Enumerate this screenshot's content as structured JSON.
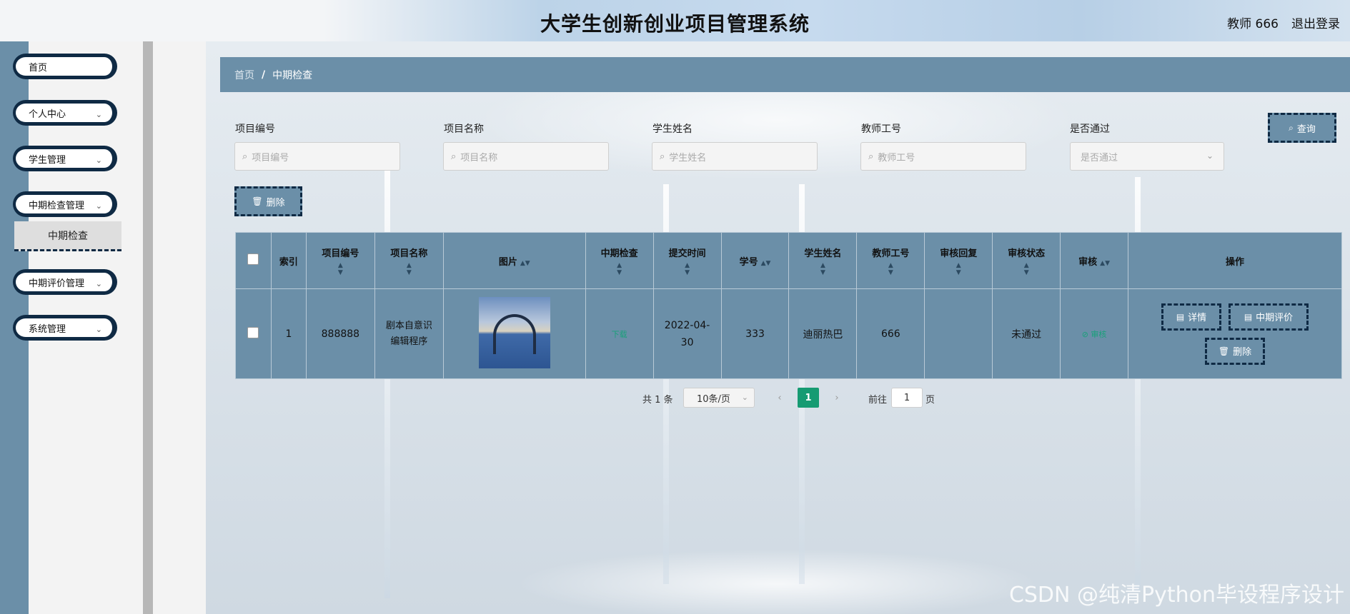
{
  "header": {
    "title": "大学生创新创业项目管理系统",
    "user": "教师 666",
    "logout": "退出登录"
  },
  "sidebar": {
    "items": [
      {
        "label": "首页"
      },
      {
        "label": "个人中心"
      },
      {
        "label": "学生管理"
      },
      {
        "label": "中期检查管理"
      },
      {
        "label": "中期评价管理"
      },
      {
        "label": "系统管理"
      }
    ],
    "subitem": "中期检查",
    "chevron": "⌄"
  },
  "breadcrumb": {
    "home": "首页",
    "separator": "/",
    "current": "中期检查"
  },
  "filters": {
    "project_no": {
      "label": "项目编号",
      "placeholder": "项目编号"
    },
    "project_name": {
      "label": "项目名称",
      "placeholder": "项目名称"
    },
    "student_name": {
      "label": "学生姓名",
      "placeholder": "学生姓名"
    },
    "teacher_no": {
      "label": "教师工号",
      "placeholder": "教师工号"
    },
    "passed": {
      "label": "是否通过",
      "placeholder": "是否通过"
    },
    "search_button": "查询",
    "delete_button": "删除"
  },
  "table": {
    "headers": {
      "index": "索引",
      "project_no": "项目编号",
      "project_name": "项目名称",
      "image": "图片",
      "midterm": "中期检查",
      "submit_time": "提交时间",
      "student_no": "学号",
      "student_name": "学生姓名",
      "teacher_no": "教师工号",
      "review_reply": "审核回复",
      "review_status": "审核状态",
      "audit": "审核",
      "actions": "操作"
    },
    "rows": [
      {
        "index": "1",
        "project_no": "888888",
        "project_name": "剧本自意识编辑程序",
        "midterm_link": "下载",
        "submit_time": "2022-04-30",
        "student_no": "333",
        "student_name": "迪丽热巴",
        "teacher_no": "666",
        "review_reply": "",
        "review_status": "未通过",
        "audit_link": "⊘ 审核",
        "detail_button": "详情",
        "evaluate_button": "中期评价",
        "delete_button": "删除"
      }
    ]
  },
  "pagination": {
    "total": "共 1 条",
    "page_size": "10条/页",
    "current_page": "1",
    "goto_label": "前往",
    "goto_value": "1",
    "page_unit": "页"
  },
  "watermark": "CSDN @纯清Python毕设程序设计",
  "colors": {
    "primary": "#6b8fa8",
    "border_dark": "#0f2a44",
    "accent_green": "#169b72"
  }
}
